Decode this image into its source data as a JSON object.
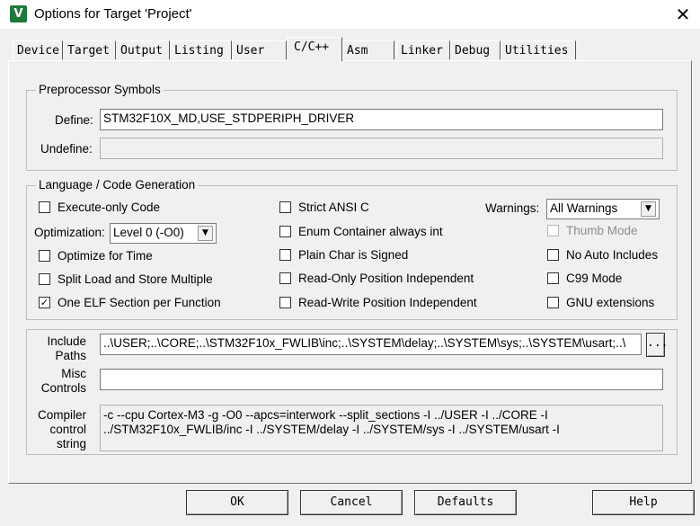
{
  "window": {
    "title": "Options for Target 'Project'",
    "app_icon_glyph": "V",
    "close_glyph": "✕"
  },
  "tabs": [
    "Device",
    "Target",
    "Output",
    "Listing",
    "User",
    "C/C++",
    "Asm",
    "Linker",
    "Debug",
    "Utilities"
  ],
  "active_tab": "C/C++",
  "preprocessor": {
    "group_label": "Preprocessor Symbols",
    "define_label": "Define:",
    "define_value": "STM32F10X_MD,USE_STDPERIPH_DRIVER",
    "undefine_label": "Undefine:",
    "undefine_value": ""
  },
  "codegen": {
    "group_label": "Language / Code Generation",
    "execute_only": {
      "label": "Execute-only Code",
      "checked": false
    },
    "optimization_label": "Optimization:",
    "optimization_value": "Level 0 (-O0)",
    "optimize_time": {
      "label": "Optimize for Time",
      "checked": false
    },
    "split_load": {
      "label": "Split Load and Store Multiple",
      "checked": false
    },
    "one_elf": {
      "label": "One ELF Section per Function",
      "checked": true
    },
    "strict_ansi": {
      "label": "Strict ANSI C",
      "checked": false
    },
    "enum_container": {
      "label": "Enum Container always int",
      "checked": false
    },
    "plain_char": {
      "label": "Plain Char is Signed",
      "checked": false
    },
    "ro_pi": {
      "label": "Read-Only Position Independent",
      "checked": false
    },
    "rw_pi": {
      "label": "Read-Write Position Independent",
      "checked": false
    },
    "warnings_label": "Warnings:",
    "warnings_value": "All Warnings",
    "thumb_mode": {
      "label": "Thumb Mode",
      "checked": false,
      "enabled": false
    },
    "no_auto_includes": {
      "label": "No Auto Includes",
      "checked": false
    },
    "c99_mode": {
      "label": "C99 Mode",
      "checked": false
    },
    "gnu_extensions": {
      "label": "GNU extensions",
      "checked": false
    },
    "check_glyph": "✓"
  },
  "include": {
    "label_line1": "Include",
    "label_line2": "Paths",
    "value": "..\\USER;..\\CORE;..\\STM32F10x_FWLIB\\inc;..\\SYSTEM\\delay;..\\SYSTEM\\sys;..\\SYSTEM\\usart;..\\",
    "browse_label": "..."
  },
  "misc": {
    "label_line1": "Misc",
    "label_line2": "Controls",
    "value": ""
  },
  "compiler": {
    "label_line1": "Compiler",
    "label_line2": "control",
    "label_line3": "string",
    "line1": "-c --cpu Cortex-M3 -g -O0 --apcs=interwork --split_sections -I ../USER -I ../CORE -I",
    "line2": "../STM32F10x_FWLIB/inc -I ../SYSTEM/delay -I ../SYSTEM/sys -I ../SYSTEM/usart -I"
  },
  "buttons": {
    "ok": "OK",
    "cancel": "Cancel",
    "defaults": "Defaults",
    "help": "Help"
  },
  "icons": {
    "dropdown": "▼"
  }
}
